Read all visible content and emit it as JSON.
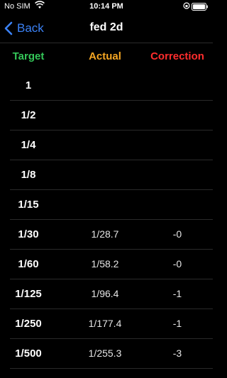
{
  "status": {
    "carrier": "No SIM",
    "time": "10:14 PM"
  },
  "nav": {
    "back_label": "Back",
    "title": "fed 2d"
  },
  "table": {
    "headers": {
      "target": "Target",
      "actual": "Actual",
      "correction": "Correction"
    },
    "header_colors": {
      "target": "#34c759",
      "actual": "#f5a623",
      "correction": "#ff2d2d"
    },
    "rows": [
      {
        "target": "1",
        "actual": "",
        "correction": ""
      },
      {
        "target": "1/2",
        "actual": "",
        "correction": ""
      },
      {
        "target": "1/4",
        "actual": "",
        "correction": ""
      },
      {
        "target": "1/8",
        "actual": "",
        "correction": ""
      },
      {
        "target": "1/15",
        "actual": "",
        "correction": ""
      },
      {
        "target": "1/30",
        "actual": "1/28.7",
        "correction": "-0"
      },
      {
        "target": "1/60",
        "actual": "1/58.2",
        "correction": "-0"
      },
      {
        "target": "1/125",
        "actual": "1/96.4",
        "correction": "-1"
      },
      {
        "target": "1/250",
        "actual": "1/177.4",
        "correction": "-1"
      },
      {
        "target": "1/500",
        "actual": "1/255.3",
        "correction": "-3"
      }
    ]
  },
  "icons": {
    "wifi": "wifi-icon",
    "lock": "orientation-lock-icon",
    "battery": "battery-icon",
    "back": "chevron-left-icon"
  },
  "colors": {
    "accent": "#3b82f6",
    "background": "#000000"
  }
}
